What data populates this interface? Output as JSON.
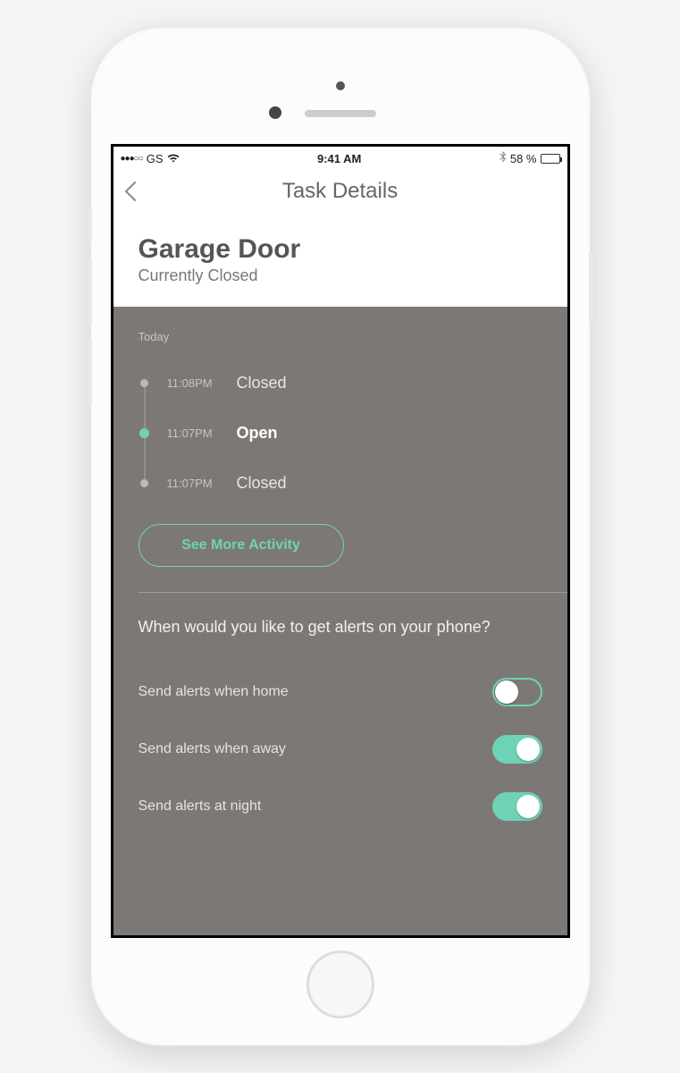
{
  "status_bar": {
    "carrier": "GS",
    "time": "9:41 AM",
    "battery_pct": "58 %",
    "signal_dots": "●●●○○"
  },
  "nav": {
    "title": "Task Details"
  },
  "device": {
    "name": "Garage Door",
    "status": "Currently Closed"
  },
  "activity": {
    "day_label": "Today",
    "events": [
      {
        "time": "11:08PM",
        "state": "Closed",
        "active": false
      },
      {
        "time": "11:07PM",
        "state": "Open",
        "active": true
      },
      {
        "time": "11:07PM",
        "state": "Closed",
        "active": false
      }
    ],
    "see_more_label": "See More Activity"
  },
  "alerts": {
    "question": "When would you like to get alerts on your phone?",
    "rows": [
      {
        "label": "Send alerts when home",
        "on": false
      },
      {
        "label": "Send alerts when away",
        "on": true
      },
      {
        "label": "Send alerts at night",
        "on": true
      }
    ]
  },
  "colors": {
    "accent": "#6ed3b6",
    "body_bg": "#7c7876"
  }
}
